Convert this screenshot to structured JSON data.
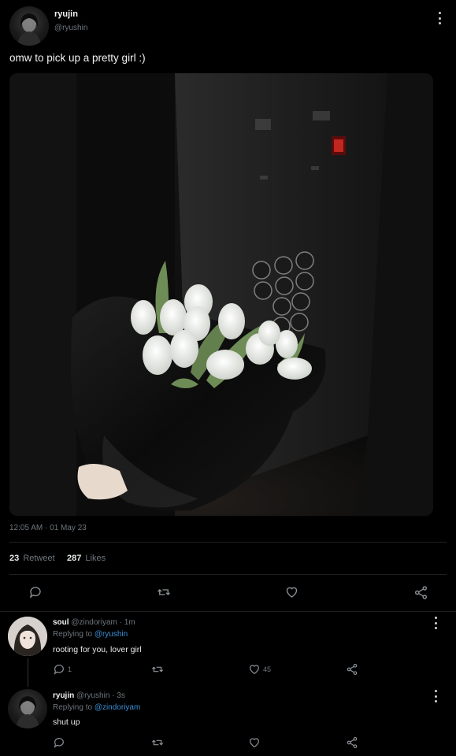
{
  "tweet": {
    "name": "ryujin",
    "handle": "@ryushin",
    "text": "omw to pick up a pretty girl :)",
    "timestamp": "12:05 AM · 01 May 23",
    "retweets_count": "23",
    "retweets_label": "Retweet",
    "likes_count": "287",
    "likes_label": "Likes"
  },
  "replies": [
    {
      "name": "soul",
      "handle": "@zindoriyam",
      "time": "· 1m",
      "replying_label": "Replying to",
      "replying_to": "@ryushin",
      "text": "rooting for you, lover girl",
      "reply_count": "1",
      "like_count": "45"
    },
    {
      "name": "ryujin",
      "handle": "@ryushin",
      "time": "· 3s",
      "replying_label": "Replying to",
      "replying_to": "@zindoriyam",
      "text": "shut up"
    }
  ],
  "icons": {
    "reply": "reply-icon",
    "retweet": "retweet-icon",
    "like": "heart-icon",
    "share": "share-icon",
    "more": "more-vertical-icon"
  },
  "colors": {
    "background": "#000000",
    "link": "#3b8fd6",
    "muted": "#6e767d"
  }
}
